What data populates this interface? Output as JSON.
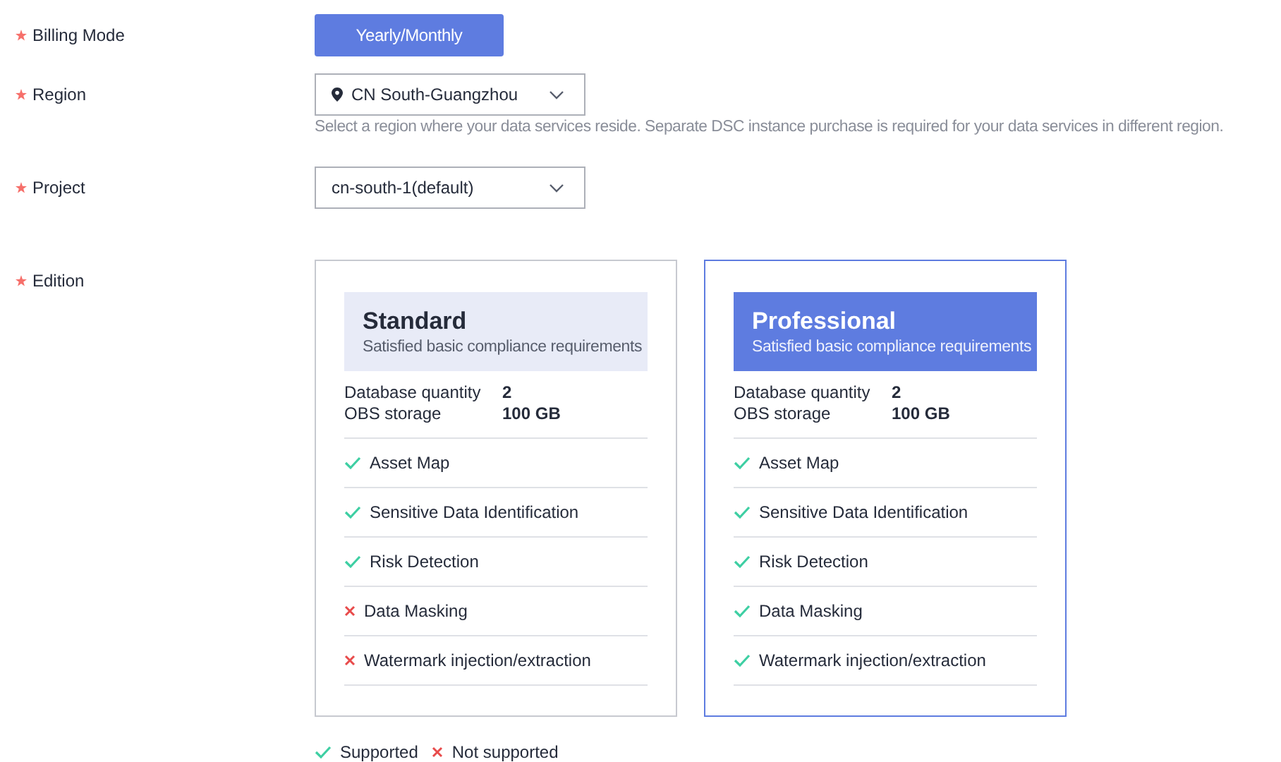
{
  "fields": [
    {
      "kind": "button",
      "label": "Billing Mode",
      "required": true,
      "value": "Yearly/Monthly"
    },
    {
      "kind": "select",
      "label": "Region",
      "required": true,
      "value": "CN South-Guangzhou",
      "location": true,
      "hint": "Select a region where your data services reside. Separate DSC instance purchase is required for your data services in different region."
    },
    {
      "kind": "select",
      "label": "Project",
      "required": true,
      "value": "cn-south-1(default)",
      "location": false
    },
    {
      "kind": "editions",
      "label": "Edition",
      "required": true
    }
  ],
  "editions": [
    {
      "name": "Standard",
      "description": "Satisfied basic compliance requirements",
      "selected": false,
      "specs": [
        {
          "label": "Database quantity",
          "value": "2"
        },
        {
          "label": "OBS storage",
          "value": "100 GB"
        }
      ],
      "features": [
        {
          "label": "Asset Map",
          "supported": true
        },
        {
          "label": "Sensitive Data Identification",
          "supported": true
        },
        {
          "label": "Risk Detection",
          "supported": true
        },
        {
          "label": "Data Masking",
          "supported": false
        },
        {
          "label": "Watermark injection/extraction",
          "supported": false
        }
      ]
    },
    {
      "name": "Professional",
      "description": "Satisfied basic compliance requirements",
      "selected": true,
      "specs": [
        {
          "label": "Database quantity",
          "value": "2"
        },
        {
          "label": "OBS storage",
          "value": "100 GB"
        }
      ],
      "features": [
        {
          "label": "Asset Map",
          "supported": true
        },
        {
          "label": "Sensitive Data Identification",
          "supported": true
        },
        {
          "label": "Risk Detection",
          "supported": true
        },
        {
          "label": "Data Masking",
          "supported": true
        },
        {
          "label": "Watermark injection/extraction",
          "supported": true
        }
      ]
    }
  ],
  "legend": [
    {
      "label": "Supported",
      "supported": true
    },
    {
      "label": "Not supported",
      "supported": false
    }
  ]
}
